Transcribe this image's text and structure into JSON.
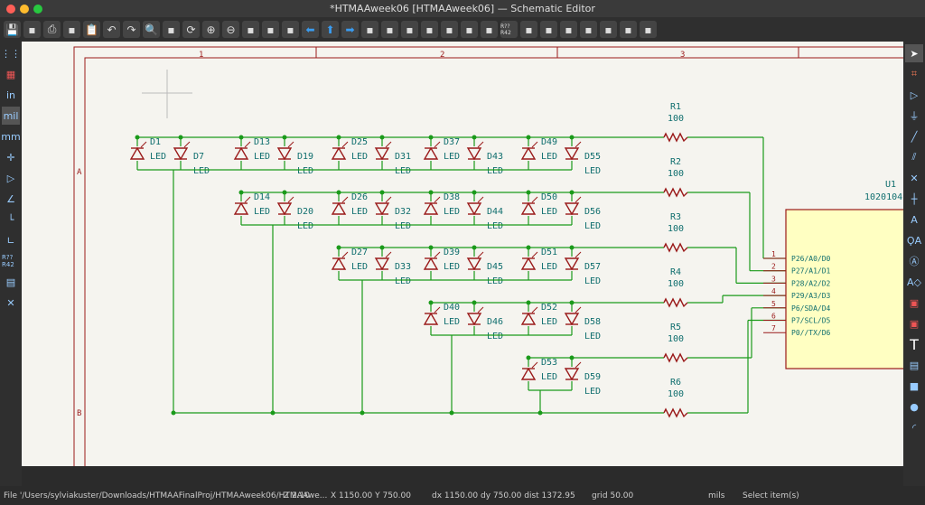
{
  "window": {
    "title": "*HTMAAweek06 [HTMAAweek06] — Schematic Editor"
  },
  "toolbar": {
    "icons": [
      "save",
      "page-settings",
      "print",
      "plot",
      "paste",
      "undo",
      "redo",
      "find",
      "find-replace",
      "refresh",
      "zoom-in",
      "zoom-out",
      "zoom-fit",
      "zoom-objects",
      "zoom-selection",
      "left",
      "up",
      "right",
      "rotate-ccw",
      "rotate-cw",
      "mirror-v",
      "mirror-h",
      "symbol-editor",
      "symbol-browser",
      "footprint-editor",
      "annotate",
      "erc",
      "simulator",
      "assign-footprints",
      "bom",
      "netlist",
      "pcb",
      "scripting"
    ],
    "annotate_label": "R?? R42"
  },
  "left_toolbar": {
    "units_in": "in",
    "units_mil": "mil",
    "units_mm": "mm",
    "annotate": "R?? R42"
  },
  "sheet": {
    "columns": [
      "1",
      "2",
      "3"
    ],
    "rows": [
      "A",
      "B"
    ]
  },
  "diodes": {
    "value": "LED",
    "rows": [
      [
        "D1",
        "D7",
        "D13",
        "D19",
        "D25",
        "D31",
        "D37",
        "D43",
        "D49",
        "D55"
      ],
      [
        "D14",
        "D20",
        "D26",
        "D32",
        "D38",
        "D44",
        "D50",
        "D56"
      ],
      [
        "D27",
        "D33",
        "D39",
        "D45",
        "D51",
        "D57"
      ],
      [
        "D40",
        "D46",
        "D52",
        "D58"
      ],
      [
        "D53",
        "D59"
      ]
    ]
  },
  "resistors": [
    {
      "ref": "R1",
      "value": "100"
    },
    {
      "ref": "R2",
      "value": "100"
    },
    {
      "ref": "R3",
      "value": "100"
    },
    {
      "ref": "R4",
      "value": "100"
    },
    {
      "ref": "R5",
      "value": "100"
    },
    {
      "ref": "R6",
      "value": "100"
    }
  ],
  "u1": {
    "ref": "U1",
    "value": "1020104",
    "pins": [
      {
        "num": "1",
        "name": "P26/A0/D0"
      },
      {
        "num": "2",
        "name": "P27/A1/D1"
      },
      {
        "num": "3",
        "name": "P28/A2/D2"
      },
      {
        "num": "4",
        "name": "P29/A3/D3"
      },
      {
        "num": "5",
        "name": "P6/SDA/D4"
      },
      {
        "num": "6",
        "name": "P7/SCL/D5"
      },
      {
        "num": "7",
        "name": "P0//TX/D6"
      }
    ]
  },
  "colors": {
    "wire": "#1a9a1a",
    "component": "#9a1a1a",
    "text": "#0f6e6e",
    "body": "#ffffc2"
  },
  "status": {
    "file": "File '/Users/sylviakuster/Downloads/HTMAAFinalProj/HTMAAweek06/HTMAAwe...",
    "zoom": "Z 2.10",
    "xy": "X 1150.00  Y 750.00",
    "dxy": "dx 1150.00  dy 750.00  dist 1372.95",
    "grid": "grid 50.00",
    "units": "mils",
    "mode": "Select item(s)"
  }
}
